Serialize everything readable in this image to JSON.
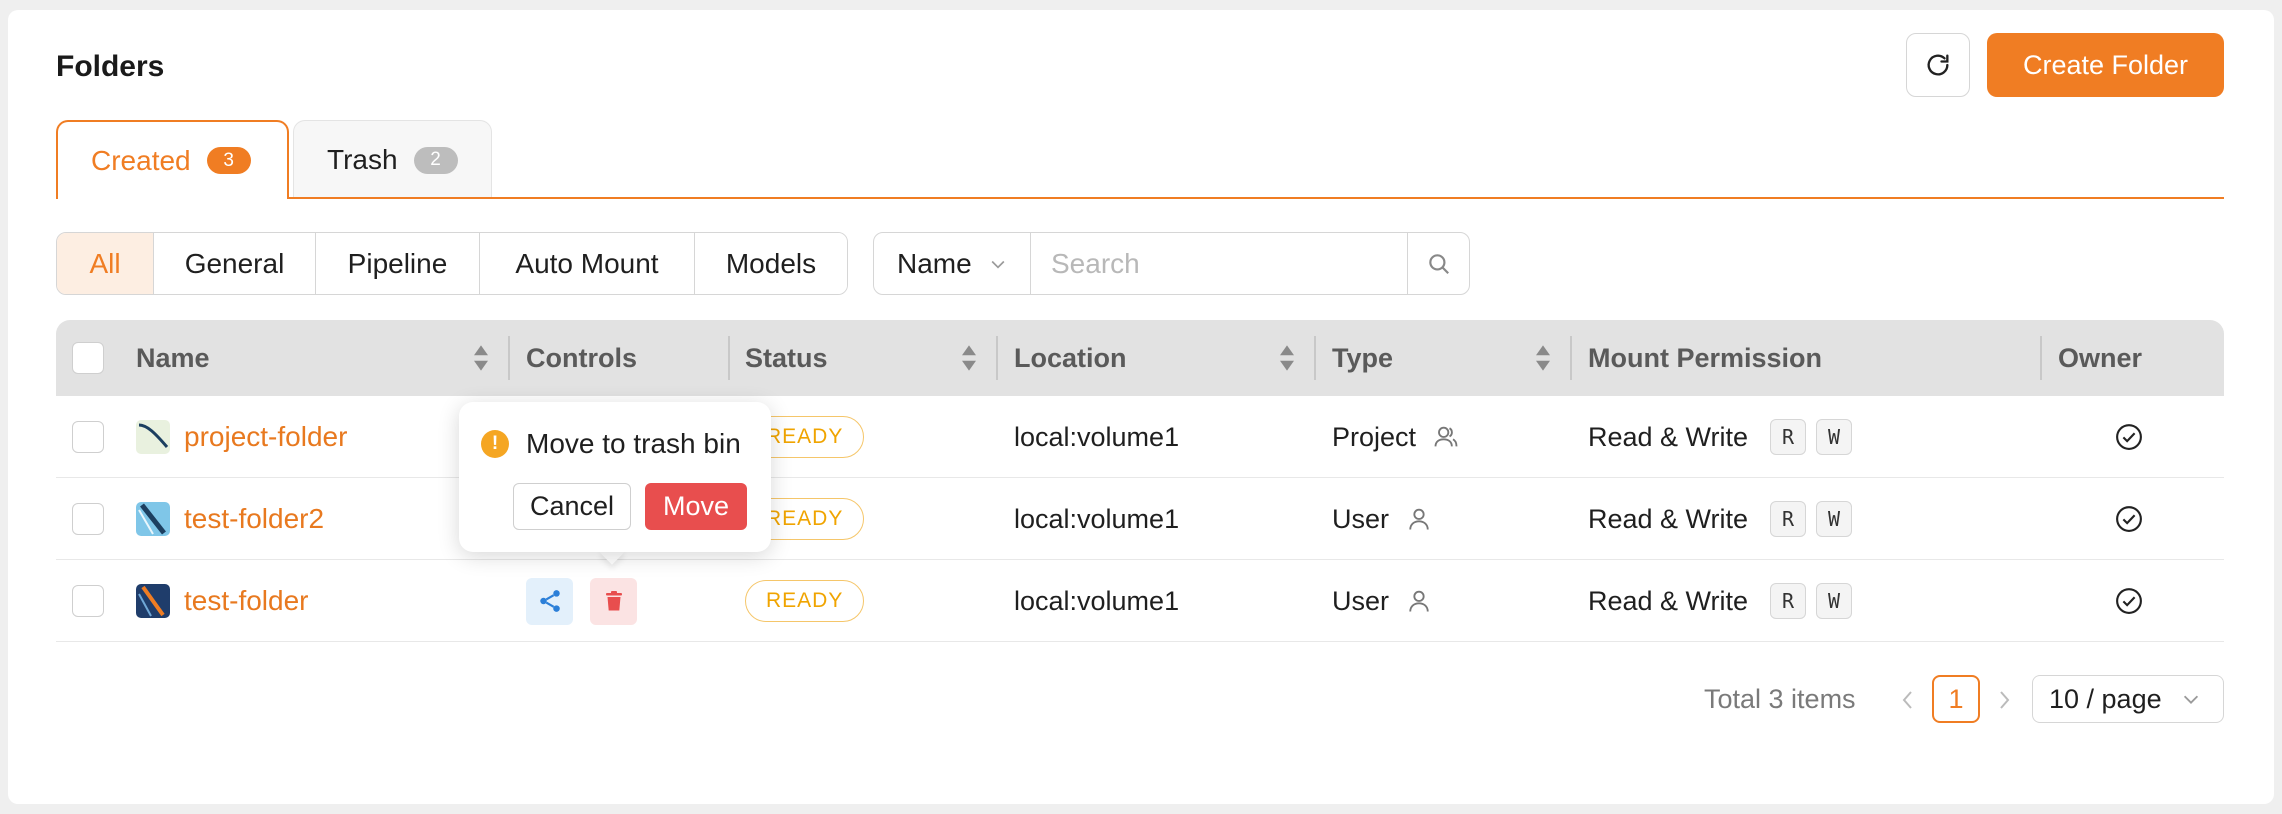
{
  "header": {
    "title": "Folders",
    "create_label": "Create Folder"
  },
  "tabs": [
    {
      "label": "Created",
      "count": "3"
    },
    {
      "label": "Trash",
      "count": "2"
    }
  ],
  "filters": [
    "All",
    "General",
    "Pipeline",
    "Auto Mount",
    "Models"
  ],
  "search": {
    "field": "Name",
    "placeholder": "Search"
  },
  "columns": [
    "Name",
    "Controls",
    "Status",
    "Location",
    "Type",
    "Mount Permission",
    "Owner"
  ],
  "rows": [
    {
      "name": "project-folder",
      "status": "READY",
      "location": "local:volume1",
      "type": "Project",
      "permission": "Read & Write",
      "r": "R",
      "w": "W"
    },
    {
      "name": "test-folder2",
      "status": "READY",
      "location": "local:volume1",
      "type": "User",
      "permission": "Read & Write",
      "r": "R",
      "w": "W"
    },
    {
      "name": "test-folder",
      "status": "READY",
      "location": "local:volume1",
      "type": "User",
      "permission": "Read & Write",
      "r": "R",
      "w": "W"
    }
  ],
  "popconfirm": {
    "title": "Move to trash bin",
    "cancel": "Cancel",
    "confirm": "Move"
  },
  "pagination": {
    "total": "Total 3 items",
    "page": "1",
    "page_size": "10 / page"
  },
  "colors": {
    "accent": "#f07d23",
    "danger": "#e84e4e",
    "ready": "#f0a400"
  }
}
